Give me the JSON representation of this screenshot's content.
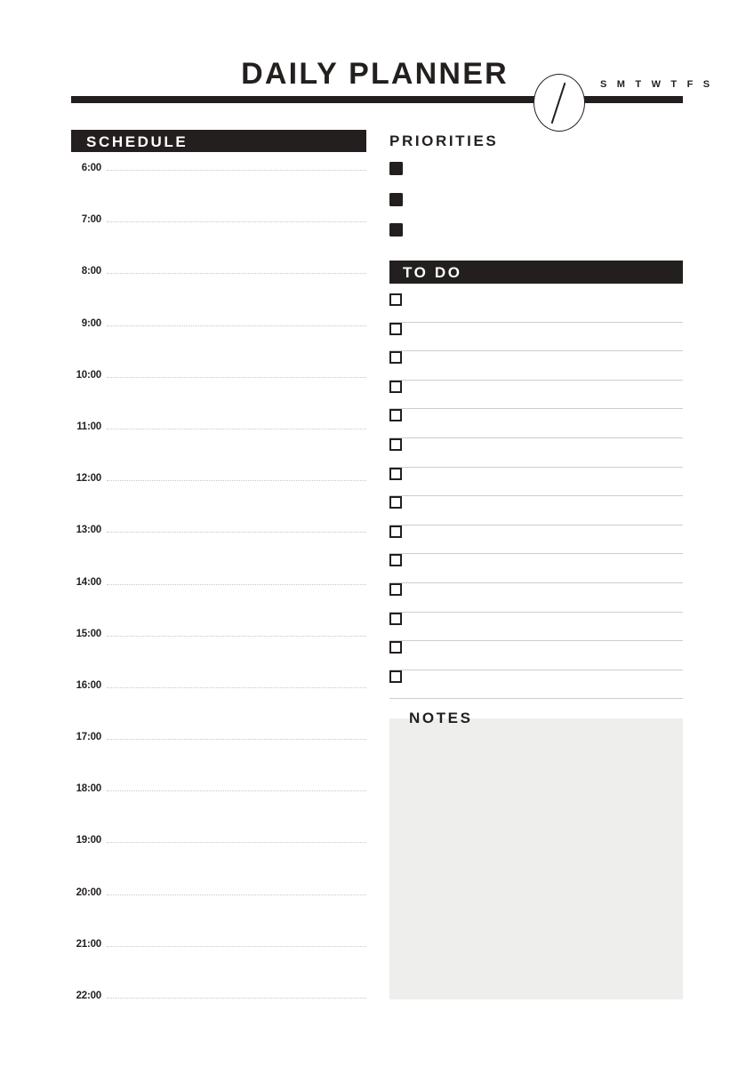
{
  "header": {
    "title": "DAILY PLANNER",
    "weekday_letters": "S M T W T F S",
    "date_field_placeholder": "",
    "date_slash_icon": "slash-icon",
    "accent_color": "#231f1e"
  },
  "schedule": {
    "heading": "SCHEDULE",
    "times": [
      "6:00",
      "7:00",
      "8:00",
      "9:00",
      "10:00",
      "11:00",
      "12:00",
      "13:00",
      "14:00",
      "15:00",
      "16:00",
      "17:00",
      "18:00",
      "19:00",
      "20:00",
      "21:00",
      "22:00"
    ],
    "entries": [
      "",
      "",
      "",
      "",
      "",
      "",
      "",
      "",
      "",
      "",
      "",
      "",
      "",
      "",
      "",
      "",
      ""
    ]
  },
  "priorities": {
    "heading": "PRIORITIES",
    "items": [
      {
        "checked": true,
        "text": ""
      },
      {
        "checked": true,
        "text": ""
      },
      {
        "checked": true,
        "text": ""
      }
    ]
  },
  "todo": {
    "heading": "TO DO",
    "items": [
      {
        "checked": false,
        "text": ""
      },
      {
        "checked": false,
        "text": ""
      },
      {
        "checked": false,
        "text": ""
      },
      {
        "checked": false,
        "text": ""
      },
      {
        "checked": false,
        "text": ""
      },
      {
        "checked": false,
        "text": ""
      },
      {
        "checked": false,
        "text": ""
      },
      {
        "checked": false,
        "text": ""
      },
      {
        "checked": false,
        "text": ""
      },
      {
        "checked": false,
        "text": ""
      },
      {
        "checked": false,
        "text": ""
      },
      {
        "checked": false,
        "text": ""
      },
      {
        "checked": false,
        "text": ""
      },
      {
        "checked": false,
        "text": ""
      }
    ]
  },
  "notes": {
    "heading": "NOTES",
    "text": "",
    "fill_color": "#eeeeed"
  }
}
